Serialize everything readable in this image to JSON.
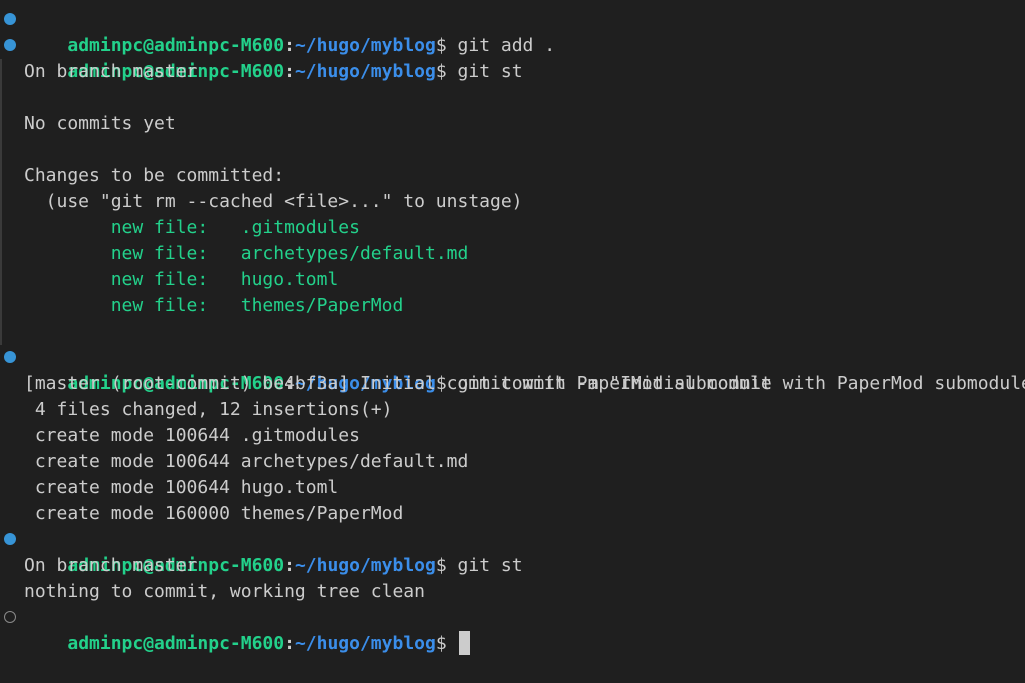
{
  "prompt": {
    "user": "adminpc@adminpc-M600",
    "sep": ":",
    "path": "~/hugo/myblog",
    "dollar": "$ "
  },
  "lines": {
    "l0_cmd": "git add .",
    "l1_cmd": "git st",
    "l2": "On branch master",
    "l3": "",
    "l4": "No commits yet",
    "l5": "",
    "l6": "Changes to be committed:",
    "l7": "  (use \"git rm --cached <file>...\" to unstage)",
    "l8_label": "        new file:   ",
    "l8_file": ".gitmodules",
    "l9_label": "        new file:   ",
    "l9_file": "archetypes/default.md",
    "l10_label": "        new file:   ",
    "l10_file": "hugo.toml",
    "l11_label": "        new file:   ",
    "l11_file": "themes/PaperMod",
    "l12": "",
    "l13_cmd": "git commit -m \"Initial commit with PaperMod submodule\"",
    "l14": "[master (root-commit) be4bf3a] Initial commit with PaperMod submodule",
    "l15": " 4 files changed, 12 insertions(+)",
    "l16": " create mode 100644 .gitmodules",
    "l17": " create mode 100644 archetypes/default.md",
    "l18": " create mode 100644 hugo.toml",
    "l19": " create mode 160000 themes/PaperMod",
    "l20_cmd": "git st",
    "l21": "On branch master",
    "l22": "nothing to commit, working tree clean",
    "l23_cmd": ""
  },
  "colors": {
    "background": "#1f1f1f",
    "foreground": "#cccccc",
    "user": "#23d18b",
    "path": "#3b8eea",
    "success_dot": "#3794d6",
    "staged_file": "#23d18b"
  },
  "icons": {
    "command_success": "circle-filled-icon",
    "command_pending": "circle-outline-icon"
  }
}
